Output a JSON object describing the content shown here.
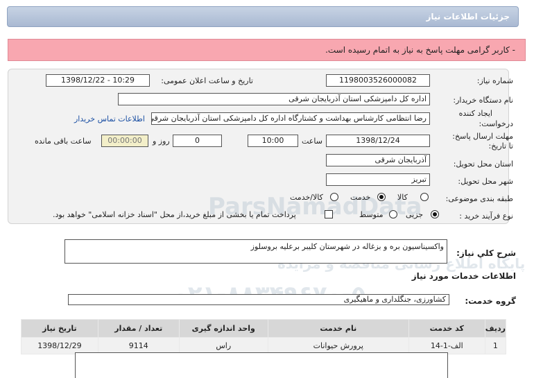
{
  "header": {
    "title": "جزئیات اطلاعات نیاز"
  },
  "alert": {
    "message": "- کاربر گرامی مهلت پاسخ به نیاز به اتمام رسیده است."
  },
  "fields": {
    "need_number_label": "شماره نیاز:",
    "need_number": "1198003526000082",
    "announce_label": "تاریخ و ساعت اعلان عمومی:",
    "announce_value": "1398/12/22 - 10:29",
    "buyer_label": "نام دستگاه خریدار:",
    "buyer_value": "اداره کل دامپزشکی استان آذربایجان شرقی",
    "creator_label_1": "ایجاد کننده",
    "creator_label_2": "درخواست:",
    "creator_value": "رضا انتظامی کارشناس بهداشت و کشتارگاه اداره کل دامپزشکی استان آذربایجان شرقی",
    "contact_link": "اطلاعات تماس خریدار",
    "deadline_label_1": "مهلت ارسال پاسخ:",
    "deadline_label_2": "تا تاریخ:",
    "deadline_date": "1398/12/24",
    "time_label": "ساعت",
    "deadline_time": "10:00",
    "days_value": "0",
    "days_label": "روز و",
    "remaining_time": "00:00:00",
    "remaining_label": "ساعت باقی مانده",
    "province_label": "استان محل تحویل:",
    "province_value": "آذربایجان شرقی",
    "city_label": "شهر محل تحویل:",
    "city_value": "تبریز",
    "category_label": "طبقه بندی موضوعی:",
    "category_options": [
      "کالا",
      "خدمت",
      "کالا/خدمت"
    ],
    "category_selected": "خدمت",
    "process_label": "نوع فرآیند خرید :",
    "process_options": [
      "جزیی",
      "متوسط"
    ],
    "process_selected": "جزیی",
    "payment_note": "پرداخت تمام یا بخشی از مبلغ خرید،از محل \"اسناد خزانه اسلامی\" خواهد بود."
  },
  "description": {
    "label": "شرح کلي نياز:",
    "value": "واکسیناسیون بره و بزغاله در شهرستان کلیبر برعلیه بروسلوز"
  },
  "services_section": {
    "title": "اطلاعات خدمات مورد نیاز",
    "group_label": "گروه خدمت:",
    "group_value": "کشاورزی، جنگلداری و ماهیگیری"
  },
  "table": {
    "headers": [
      "ردیف",
      "کد خدمت",
      "نام خدمت",
      "واحد اندازه گیری",
      "تعداد / مقدار",
      "تاریخ نیاز"
    ],
    "rows": [
      [
        "1",
        "الف-1-14",
        "پرورش حیوانات",
        "راس",
        "9114",
        "1398/12/29"
      ]
    ]
  },
  "watermark": {
    "line1": "ParsNamadData",
    "line2": "پایگاه اطلاع رسانی مناقصه و مزایده",
    "line3": "۰۲۱-۸۸۳۴۹۶۷۰-۵"
  }
}
